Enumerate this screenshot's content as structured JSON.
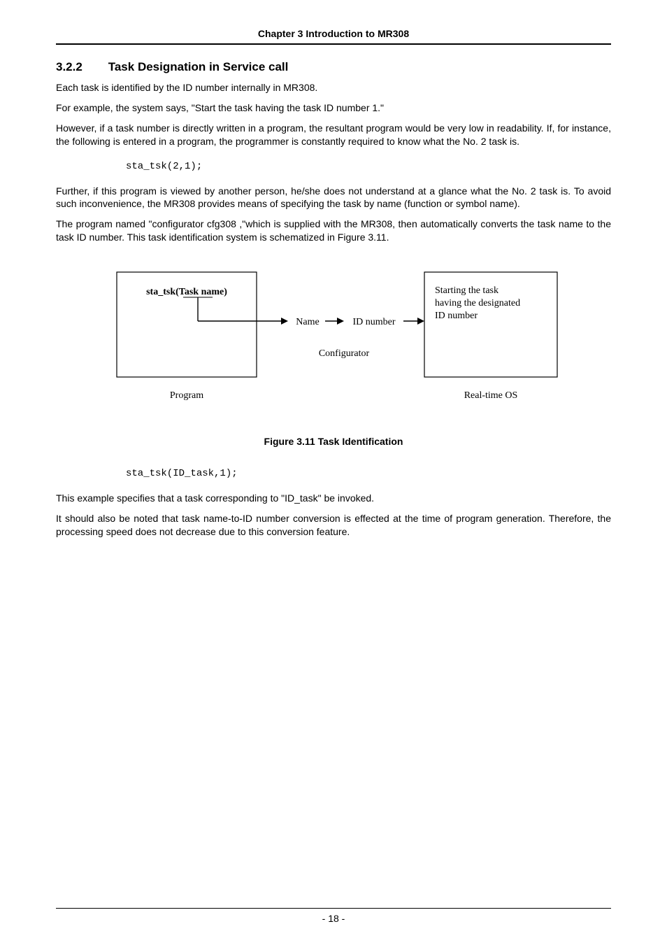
{
  "header": {
    "chapter_title": "Chapter 3 Introduction to MR308"
  },
  "section": {
    "number": "3.2.2",
    "title": "Task Designation in Service call"
  },
  "paragraphs": {
    "p1": "Each task is identified by the ID number internally in MR308.",
    "p2": "For example, the system says, \"Start the task having the task ID number 1.\"",
    "p3": "However, if a task number is directly written in a program, the resultant program would be very low in readability. If, for instance, the following is entered in a program, the programmer is constantly required to know what the No. 2 task is.",
    "p4": "Further, if this program is viewed by another person, he/she does not understand at a glance what the No. 2 task is. To avoid such inconvenience, the MR308 provides means of specifying the task by name (function or symbol name).",
    "p5": "The program named \"configurator cfg308 ,\"which is supplied with the MR308, then automatically converts the task name to the task ID number. This task identification system is schematized in Figure 3.11.",
    "p6": "This example specifies that a task corresponding to \"ID_task\" be invoked.",
    "p7": "It should also be noted that task name-to-ID number conversion is effected at the time of program generation. Therefore, the processing speed does not decrease due to this conversion feature."
  },
  "code": {
    "line1": "sta_tsk(2,1);",
    "line2": "sta_tsk(ID_task,1);"
  },
  "figure": {
    "box_left_text": "sta_tsk(Task name)",
    "arrow_label_name": "Name",
    "arrow_label_id": "ID number",
    "middle_label": "Configurator",
    "box_right_line1": "Starting the task",
    "box_right_line2": "having the designated",
    "box_right_line3": "ID number",
    "label_left": "Program",
    "label_right": "Real-time OS",
    "caption": "Figure 3.11 Task Identification"
  },
  "footer": {
    "page_number": "- 18 -"
  }
}
